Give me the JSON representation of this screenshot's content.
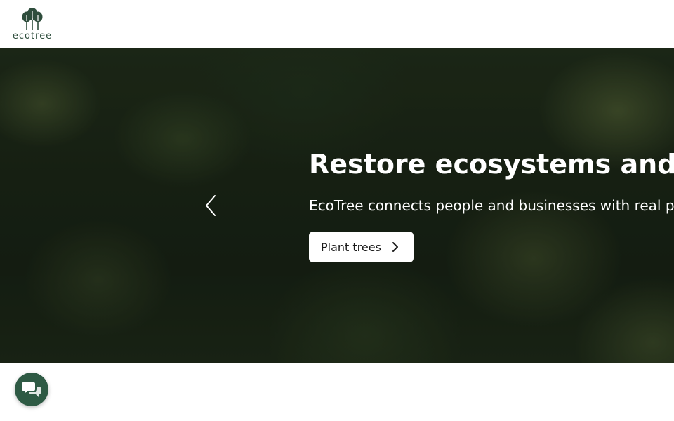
{
  "brand": {
    "name": "ecotree",
    "color": "#2e4d3c"
  },
  "hero": {
    "title": "Restore ecosystems and fi",
    "subtitle": "EcoTree connects people and businesses with real p",
    "cta_label": "Plant trees",
    "cta_icon": "chevron-right-icon",
    "prev_icon": "chevron-left-icon"
  },
  "chat": {
    "icon": "chat-bubbles-icon",
    "color": "#2e5a44"
  }
}
